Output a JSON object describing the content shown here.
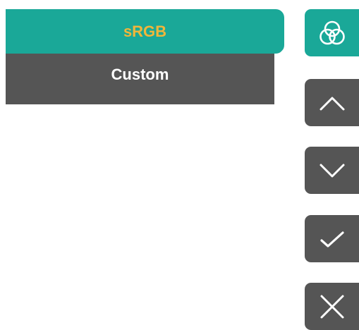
{
  "colors": {
    "accent": "#1aa898",
    "panel": "#555555",
    "selected_text": "#f1b63a",
    "text": "#ffffff"
  },
  "menu": {
    "items": [
      {
        "label": "sRGB",
        "selected": true
      },
      {
        "label": "Custom",
        "selected": false
      }
    ]
  },
  "buttons": [
    {
      "icon": "color-circles-icon",
      "active": true
    },
    {
      "icon": "chevron-up-icon",
      "active": false
    },
    {
      "icon": "chevron-down-icon",
      "active": false
    },
    {
      "icon": "checkmark-icon",
      "active": false
    },
    {
      "icon": "close-icon",
      "active": false
    }
  ]
}
